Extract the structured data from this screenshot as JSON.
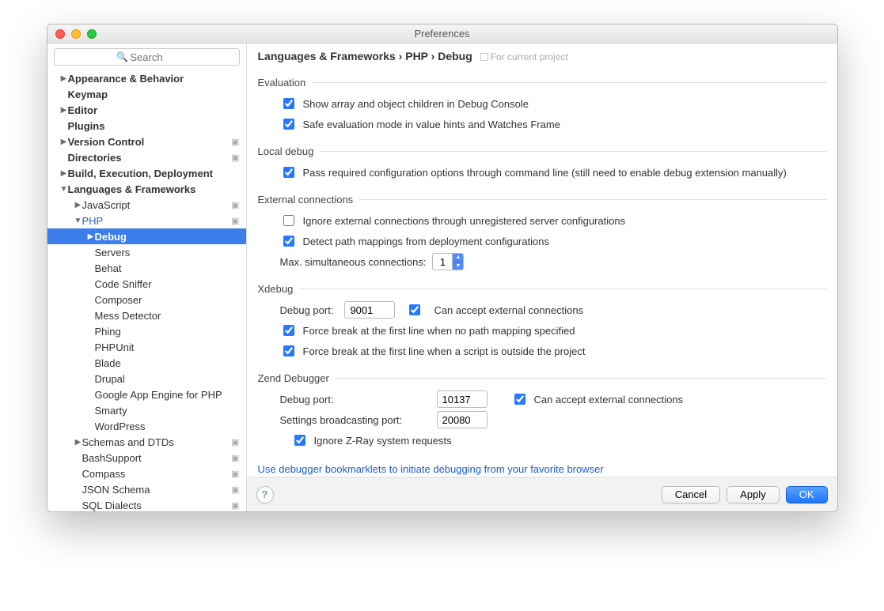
{
  "window": {
    "title": "Preferences"
  },
  "search": {
    "placeholder": "Search"
  },
  "tree": {
    "appearance": "Appearance & Behavior",
    "keymap": "Keymap",
    "editor": "Editor",
    "plugins": "Plugins",
    "vcs": "Version Control",
    "directories": "Directories",
    "build": "Build, Execution, Deployment",
    "lang": "Languages & Frameworks",
    "js": "JavaScript",
    "php": "PHP",
    "debug": "Debug",
    "servers": "Servers",
    "behat": "Behat",
    "codesniffer": "Code Sniffer",
    "composer": "Composer",
    "mess": "Mess Detector",
    "phing": "Phing",
    "phpunit": "PHPUnit",
    "blade": "Blade",
    "drupal": "Drupal",
    "gae": "Google App Engine for PHP",
    "smarty": "Smarty",
    "wordpress": "WordPress",
    "schemas": "Schemas and DTDs",
    "bash": "BashSupport",
    "compass": "Compass",
    "json": "JSON Schema",
    "sql": "SQL Dialects"
  },
  "breadcrumb": {
    "a": "Languages & Frameworks",
    "b": "PHP",
    "c": "Debug",
    "scope": "For current project"
  },
  "sections": {
    "evaluation": {
      "title": "Evaluation",
      "showChildren": "Show array and object children in Debug Console",
      "safeEval": "Safe evaluation mode in value hints and Watches Frame"
    },
    "localdebug": {
      "title": "Local debug",
      "passConfig": "Pass required configuration options through command line (still need to enable debug extension manually)"
    },
    "external": {
      "title": "External connections",
      "ignore": "Ignore external connections through unregistered server configurations",
      "detect": "Detect path mappings from deployment configurations",
      "maxconnLabel": "Max. simultaneous connections:",
      "maxconnValue": "1"
    },
    "xdebug": {
      "title": "Xdebug",
      "portLabel": "Debug port:",
      "portValue": "9001",
      "accept": "Can accept external connections",
      "fbreak1": "Force break at the first line when no path mapping specified",
      "fbreak2": "Force break at the first line when a script is outside the project"
    },
    "zend": {
      "title": "Zend Debugger",
      "portLabel": "Debug port:",
      "portValue": "10137",
      "accept": "Can accept external connections",
      "broadcastLabel": "Settings broadcasting port:",
      "broadcastValue": "20080",
      "ignoreZray": "Ignore Z-Ray system requests"
    },
    "linktext": "Use debugger bookmarklets to initiate debugging from your favorite browser"
  },
  "footer": {
    "cancel": "Cancel",
    "apply": "Apply",
    "ok": "OK"
  }
}
